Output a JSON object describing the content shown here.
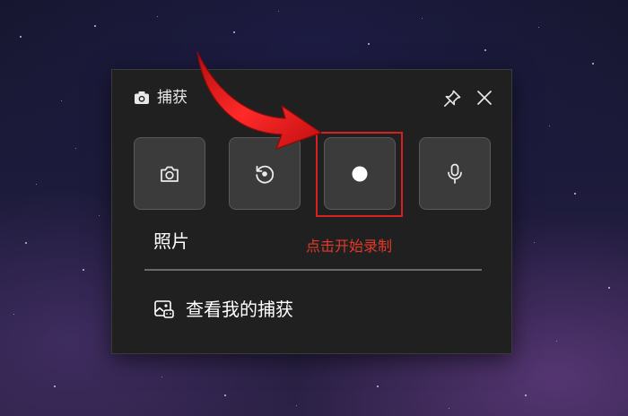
{
  "window": {
    "title": "捕获"
  },
  "capture_modes": [
    {
      "name": "photo",
      "icon": "camera-icon"
    },
    {
      "name": "recent-recording",
      "icon": "replay-icon"
    },
    {
      "name": "start-recording",
      "icon": "record-dot-icon"
    },
    {
      "name": "microphone",
      "icon": "microphone-icon"
    }
  ],
  "mode_label": "照片",
  "annotation": "点击开始录制",
  "gallery_link": {
    "label": "查看我的捕获",
    "icon": "gallery-icon"
  },
  "colors": {
    "panel_bg": "#202020",
    "tile_bg": "#3b3b3b",
    "highlight": "#d72020",
    "annotation_text": "#e23a2a",
    "arrow": "#e01818"
  }
}
